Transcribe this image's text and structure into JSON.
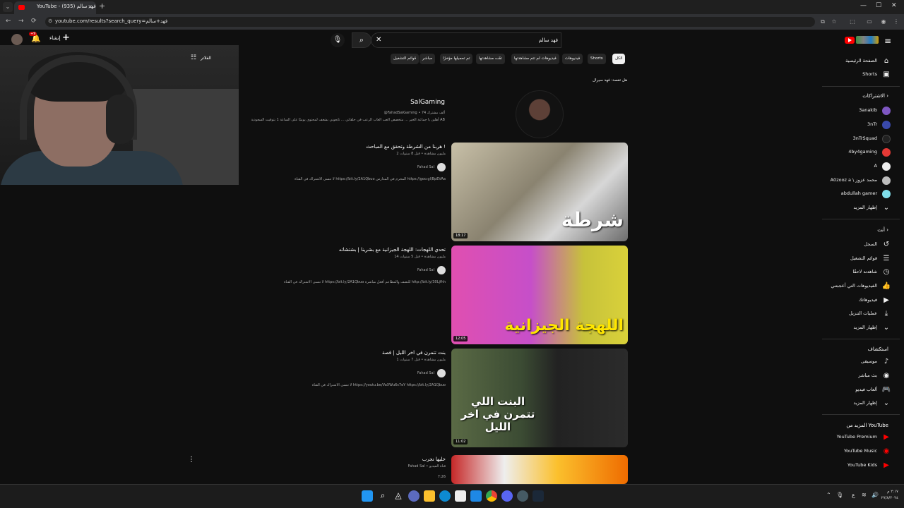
{
  "browser": {
    "tab_title": "YouTube - فهد سالم (935)",
    "tab_close": "×",
    "new_tab": "+",
    "url": "youtube.com/results?search_query=فهد+سالم",
    "window_min": "—",
    "window_max": "☐",
    "window_close": "✕"
  },
  "masthead": {
    "search_value": "فهد سالم",
    "search_placeholder": "بحث",
    "create_label": "إنشاء",
    "notifications_badge": "+9"
  },
  "chips": [
    "الكل",
    "Shorts",
    "فيديوهات",
    "فيديوهات لم تتم مشاهدتها",
    "تمّت مشاهدتها",
    "تم تحميلها مؤخرًا",
    "مباشر",
    "قوائم التشغيل"
  ],
  "filters_label": "الفلاتر",
  "did_you_mean": "هل تقصد: فهد سيرال",
  "channel": {
    "name": "SalGaming",
    "meta": "@FahadSalGaming • 74 ألف مشترك",
    "desc": "أهلين يا جماعة الخير ... متخصص العب العاب الرعب في حلقاتي ... تابعوني بشغف لمحتوى يوميًا على الساعة 1 بتوقيت السعودية AB"
  },
  "videos": [
    {
      "title": "هربنا من الشرطة وتحقق مع المباحث !",
      "meta": "2 مليون مشاهدة • قبل 8 سنوات",
      "channel": "Fahad Sal",
      "desc": "لا تنسى الاشتراك في القناة https://bit.ly/2A1Qbuo المحرم في المدارس https://goo.gl/BpEVAa",
      "duration": "18:17",
      "thumb_text": "شرطة"
    },
    {
      "title": "تحدي اللهجات: اللهجة الجيزانية مع بشرينا | بشتشاته",
      "meta": "14 مليون مشاهدة • قبل 5 سنوات",
      "channel": "Fahad Sal",
      "desc": "لا تنسى الاشتراك في القناة https://bit.ly/2A1Qbuo للنصف والمطاعم أفعل مباشرة http://bit.ly/30Ljfhh",
      "duration": "12:05",
      "thumb_text": "اللهجة الجيزانية"
    },
    {
      "title": "بنت تتمرن في اخر الليل | قصة",
      "meta": "1 مليون مشاهدة • قبل 7 سنوات",
      "channel": "Fahad Sal",
      "desc": "لا تنسى الاشتراك في القناة https://youtu.be/VaXWu6s7eY https://bit.ly/2A1Qbuo",
      "duration": "11:02",
      "thumb_text": "البنت اللي تتمرن في اخر الليل"
    },
    {
      "title": "خليها نجرب",
      "meta": "Fahad Sal • قناة الفيديو",
      "channel": "",
      "desc": "7:26",
      "duration": "",
      "thumb_text": ""
    }
  ],
  "sidebar": {
    "home": "الصفحة الرئيسية",
    "shorts": "Shorts",
    "subs_header": "الاشتراكات",
    "subscriptions": [
      {
        "name": "3anakib",
        "color": "#7e57c2"
      },
      {
        "name": "3nTr",
        "color": "#3949ab"
      },
      {
        "name": "3nTrSquad",
        "color": "#212121"
      },
      {
        "name": "4by4gaming",
        "color": "#e53935"
      },
      {
        "name": "A",
        "color": "#eeeeee"
      },
      {
        "name": "A0zooz a \\ محمد عزوز",
        "color": "#bdbdbd"
      },
      {
        "name": "abdullah gamer",
        "color": "#80deea"
      }
    ],
    "show_more_1": "إظهار المزيد",
    "you_header": "أنت",
    "you_items": [
      "السجل",
      "قوائم التشغيل",
      "شاهدته لاحقًا",
      "الفيديوهات التي أعجبتني",
      "فيديوهاتك",
      "عمليات التنزيل",
      "إظهار المزيد"
    ],
    "explore_header": "استكشاف",
    "explore_items": [
      "موسيقى",
      "بث مباشر",
      "ألعاب فيديو",
      "إظهار المزيد"
    ],
    "more_header": "المزيد من YouTube",
    "more_items": [
      "YouTube Premium",
      "YouTube Music",
      "YouTube Kids"
    ]
  },
  "taskbar": {
    "time": "٢:١٧ م",
    "date": "٢٧/٨/٢٠٢٤",
    "lang": "ع"
  }
}
